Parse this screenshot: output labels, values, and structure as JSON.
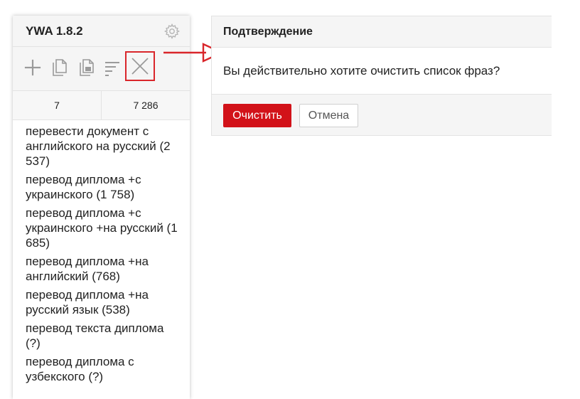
{
  "app": {
    "title": "YWA 1.8.2"
  },
  "toolbar": {
    "buttons": [
      {
        "icon": "plus-icon"
      },
      {
        "icon": "copy-icon"
      },
      {
        "icon": "copy-with-count-icon"
      },
      {
        "icon": "sort-icon"
      },
      {
        "icon": "close-icon",
        "highlighted": true
      }
    ]
  },
  "counts": {
    "left": "7",
    "right": "7 286"
  },
  "phrases": [
    "перевести документ с английского на русский (2 537)",
    "перевод диплома +с украинского (1 758)",
    "перевод диплома +с украинского +на русский (1 685)",
    "перевод диплома +на английский (768)",
    "перевод диплома +на русский язык (538)",
    "перевод текста диплома (?)",
    "перевод диплома с узбекского (?)"
  ],
  "dialog": {
    "title": "Подтверждение",
    "message": "Вы действительно хотите очистить список фраз?",
    "confirm_label": "Очистить",
    "cancel_label": "Отмена"
  },
  "colors": {
    "accent": "#d21219",
    "highlight_border": "#d9262b",
    "arrow": "#d9262b",
    "icon_gray": "#9a9a9a"
  }
}
